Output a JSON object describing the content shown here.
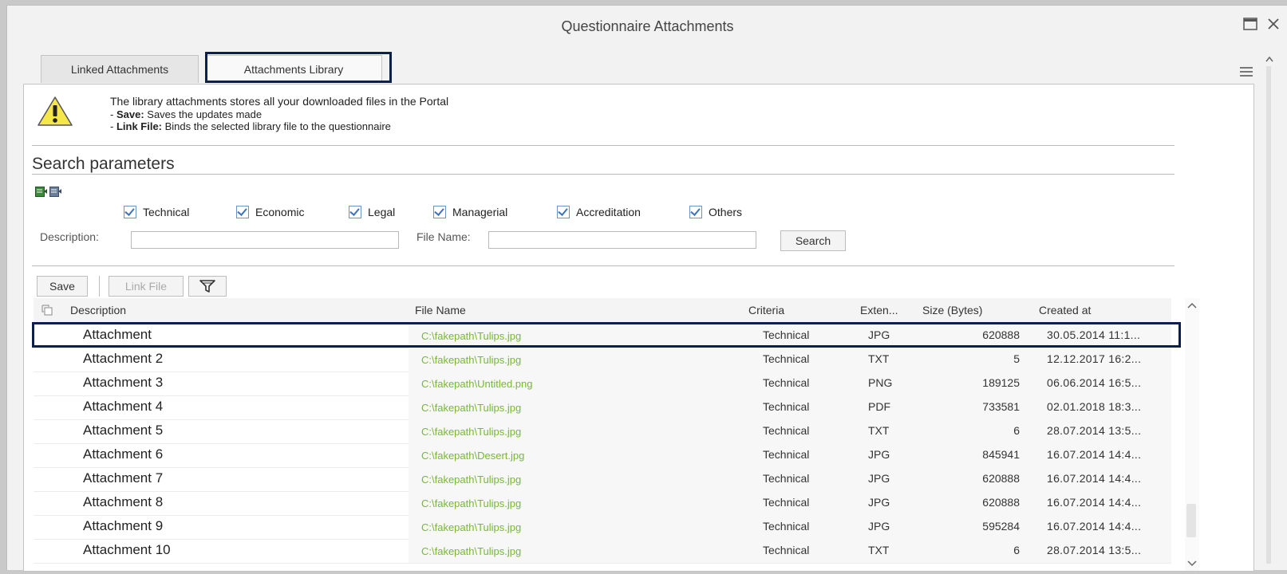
{
  "window": {
    "title": "Questionnaire Attachments",
    "maximize_icon": "□",
    "close_icon": "×"
  },
  "tabs": [
    {
      "label": "Linked Attachments"
    },
    {
      "label": "Attachments Library"
    }
  ],
  "info": {
    "line1": "The library attachments stores all your downloaded files in the Portal",
    "save_bold": "Save:",
    "save_text": " Saves the updates made",
    "link_bold": "Link File:",
    "link_text": " Binds the selected library file to the questionnaire",
    "icon": "warning-icon"
  },
  "search": {
    "title": "Search parameters",
    "categories": [
      {
        "label": "Technical",
        "checked": true
      },
      {
        "label": "Economic",
        "checked": true
      },
      {
        "label": "Legal",
        "checked": true
      },
      {
        "label": "Managerial",
        "checked": true
      },
      {
        "label": "Accreditation",
        "checked": true
      },
      {
        "label": "Others",
        "checked": true
      }
    ],
    "description_label": "Description:",
    "description_value": "",
    "filename_label": "File Name:",
    "filename_value": "",
    "search_button": "Search"
  },
  "toolbar": {
    "save": "Save",
    "link_file": "Link File",
    "filter_icon": "filter-icon"
  },
  "table": {
    "headers": {
      "description": "Description",
      "file_name": "File Name",
      "criteria": "Criteria",
      "extension": "Exten...",
      "size": "Size (Bytes)",
      "created": "Created at"
    },
    "rows": [
      {
        "description": "Attachment",
        "file": "C:\\fakepath\\Tulips.jpg",
        "criteria": "Technical",
        "ext": "JPG",
        "size": "620888",
        "created": "30.05.2014 11:1..."
      },
      {
        "description": "Attachment 2",
        "file": "C:\\fakepath\\Tulips.jpg",
        "criteria": "Technical",
        "ext": "TXT",
        "size": "5",
        "created": "12.12.2017 16:2..."
      },
      {
        "description": "Attachment 3",
        "file": "C:\\fakepath\\Untitled.png",
        "criteria": "Technical",
        "ext": "PNG",
        "size": "189125",
        "created": "06.06.2014 16:5..."
      },
      {
        "description": "Attachment 4",
        "file": "C:\\fakepath\\Tulips.jpg",
        "criteria": "Technical",
        "ext": "PDF",
        "size": "733581",
        "created": "02.01.2018 18:3..."
      },
      {
        "description": "Attachment 5",
        "file": "C:\\fakepath\\Tulips.jpg",
        "criteria": "Technical",
        "ext": "TXT",
        "size": "6",
        "created": "28.07.2014 13:5..."
      },
      {
        "description": "Attachment 6",
        "file": "C:\\fakepath\\Desert.jpg",
        "criteria": "Technical",
        "ext": "JPG",
        "size": "845941",
        "created": "16.07.2014 14:4..."
      },
      {
        "description": "Attachment 7",
        "file": "C:\\fakepath\\Tulips.jpg",
        "criteria": "Technical",
        "ext": "JPG",
        "size": "620888",
        "created": "16.07.2014 14:4..."
      },
      {
        "description": "Attachment 8",
        "file": "C:\\fakepath\\Tulips.jpg",
        "criteria": "Technical",
        "ext": "JPG",
        "size": "620888",
        "created": "16.07.2014 14:4..."
      },
      {
        "description": "Attachment 9",
        "file": "C:\\fakepath\\Tulips.jpg",
        "criteria": "Technical",
        "ext": "JPG",
        "size": "595284",
        "created": "16.07.2014 14:4..."
      },
      {
        "description": "Attachment 10",
        "file": "C:\\fakepath\\Tulips.jpg",
        "criteria": "Technical",
        "ext": "TXT",
        "size": "6",
        "created": "28.07.2014 13:5..."
      }
    ]
  },
  "colors": {
    "highlight": "#0d1f4d",
    "file_link": "#78b832",
    "check": "#3d73c0"
  }
}
